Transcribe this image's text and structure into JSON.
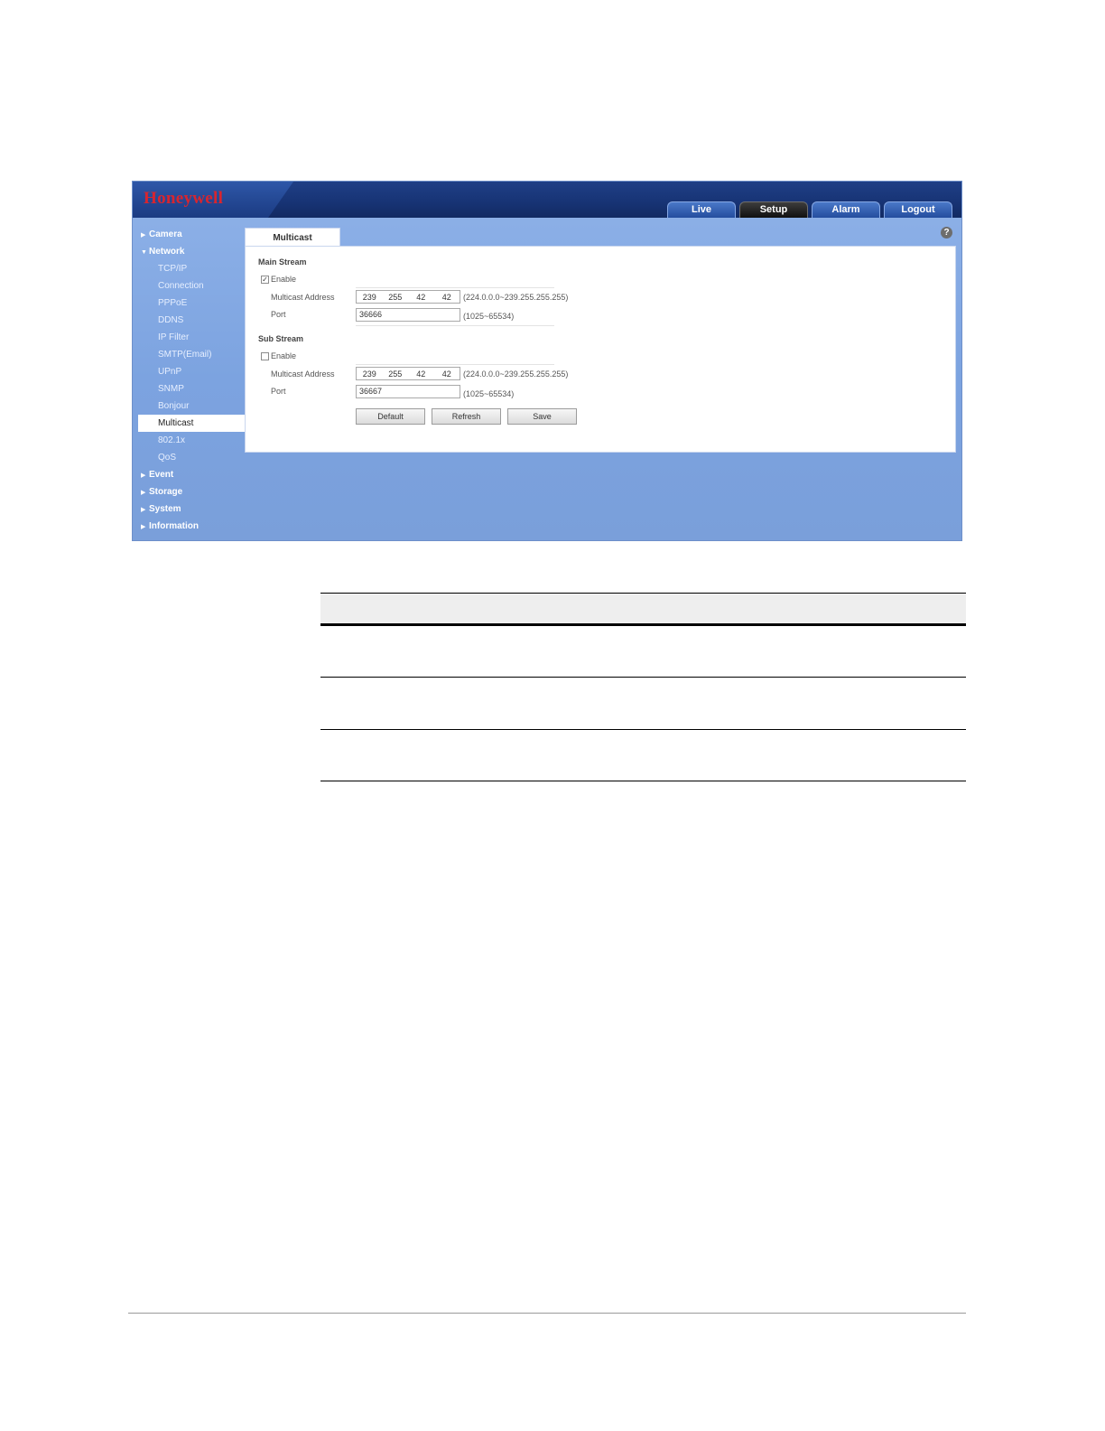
{
  "app": {
    "brand": "Honeywell",
    "tabs": [
      "Live",
      "Setup",
      "Alarm",
      "Logout"
    ],
    "active_tab": "Setup"
  },
  "sidebar": {
    "camera": "Camera",
    "network": "Network",
    "network_items": [
      "TCP/IP",
      "Connection",
      "PPPoE",
      "DDNS",
      "IP Filter",
      "SMTP(Email)",
      "UPnP",
      "SNMP",
      "Bonjour",
      "Multicast",
      "802.1x",
      "QoS"
    ],
    "event": "Event",
    "storage": "Storage",
    "system": "System",
    "information": "Information"
  },
  "page": {
    "tab_title": "Multicast",
    "main_stream": {
      "title": "Main Stream",
      "enable_label": "Enable",
      "enabled": true,
      "address_label": "Multicast Address",
      "address": [
        "239",
        "255",
        "42",
        "42"
      ],
      "address_hint": "(224.0.0.0~239.255.255.255)",
      "port_label": "Port",
      "port": "36666",
      "port_hint": "(1025~65534)"
    },
    "sub_stream": {
      "title": "Sub Stream",
      "enable_label": "Enable",
      "enabled": false,
      "address_label": "Multicast Address",
      "address": [
        "239",
        "255",
        "42",
        "42"
      ],
      "address_hint": "(224.0.0.0~239.255.255.255)",
      "port_label": "Port",
      "port": "36667",
      "port_hint": "(1025~65534)"
    },
    "buttons": {
      "default": "Default",
      "refresh": "Refresh",
      "save": "Save"
    }
  }
}
